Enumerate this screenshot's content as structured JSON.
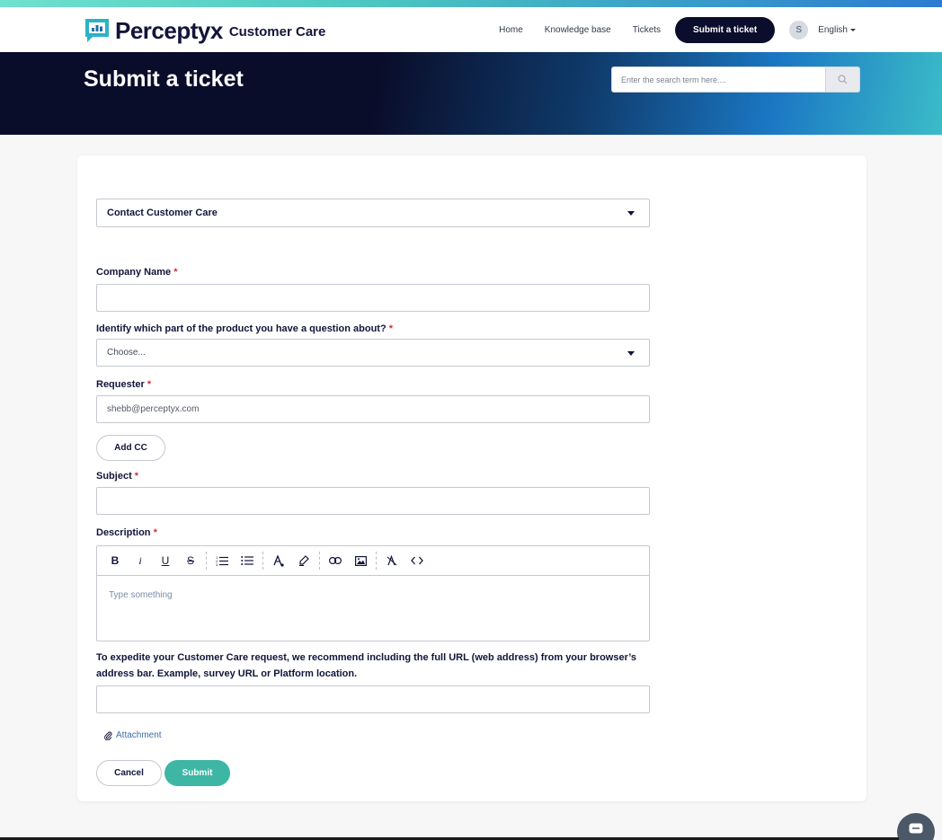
{
  "colors": {
    "brand_dark": "#0a0e2c",
    "teal": "#3db6a4",
    "required": "#d0323c",
    "link": "#3b6fa8"
  },
  "brand": {
    "name": "Perceptyx",
    "product": "Customer Care"
  },
  "nav": {
    "home": "Home",
    "knowledge_base": "Knowledge base",
    "tickets": "Tickets",
    "submit_ticket": "Submit a ticket",
    "avatar_initial": "S",
    "language": "English"
  },
  "hero": {
    "title": "Submit a ticket",
    "search_placeholder": "Enter the search term here...."
  },
  "form": {
    "ticket_form_select": "Contact Customer Care",
    "company_name": {
      "label": "Company Name",
      "required_mark": "*",
      "value": ""
    },
    "product_part": {
      "label": "Identify which part of the product you have a question about?",
      "required_mark": "*",
      "value": "Choose..."
    },
    "requester": {
      "label": "Requester",
      "required_mark": "*",
      "value": "shebb@perceptyx.com"
    },
    "add_cc_label": "Add CC",
    "subject": {
      "label": "Subject",
      "required_mark": "*",
      "value": ""
    },
    "description": {
      "label": "Description",
      "required_mark": "*",
      "placeholder": "Type something",
      "toolbar": [
        "bold-icon",
        "italic-icon",
        "underline-icon",
        "strikethrough-icon",
        "ordered-list-icon",
        "bullet-list-icon",
        "text-color-icon",
        "highlight-icon",
        "link-icon",
        "image-icon",
        "clear-format-icon",
        "code-icon"
      ]
    },
    "url_field": {
      "label": "To expedite your Customer Care request, we recommend including the full URL (web address) from your browser’s address bar. Example, survey URL or Platform location.",
      "value": ""
    },
    "attachment_label": "Attachment",
    "cancel_label": "Cancel",
    "submit_label": "Submit"
  }
}
